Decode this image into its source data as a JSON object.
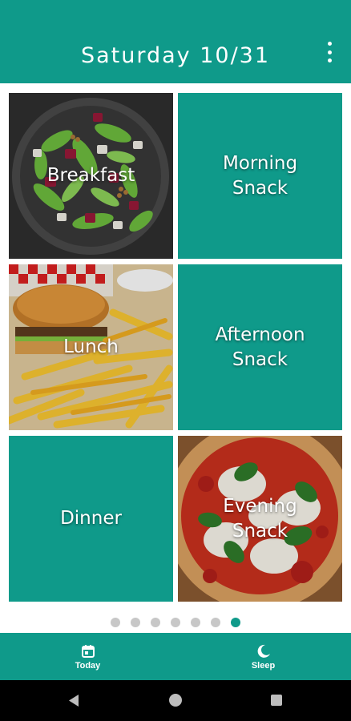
{
  "header": {
    "title": "Saturday 10/31",
    "menu_icon": "more-vert-icon"
  },
  "meals": [
    {
      "label": "Breakfast",
      "has_photo": true,
      "photo": "salad-photo"
    },
    {
      "label": "Morning\nSnack",
      "has_photo": false
    },
    {
      "label": "Lunch",
      "has_photo": true,
      "photo": "burger-fries-photo"
    },
    {
      "label": "Afternoon\nSnack",
      "has_photo": false
    },
    {
      "label": "Dinner",
      "has_photo": false
    },
    {
      "label": "Evening\nSnack",
      "has_photo": true,
      "photo": "pizza-photo"
    }
  ],
  "pager": {
    "total": 7,
    "active_index": 6
  },
  "bottom_nav": [
    {
      "label": "Today",
      "icon": "calendar-icon"
    },
    {
      "label": "Sleep",
      "icon": "moon-icon"
    }
  ],
  "system_nav": {
    "back_icon": "back-icon",
    "home_icon": "home-icon",
    "recents_icon": "recents-icon"
  },
  "colors": {
    "primary": "#0f9a8a",
    "dot_inactive": "#c7c7c7",
    "system_bar": "#000000"
  }
}
